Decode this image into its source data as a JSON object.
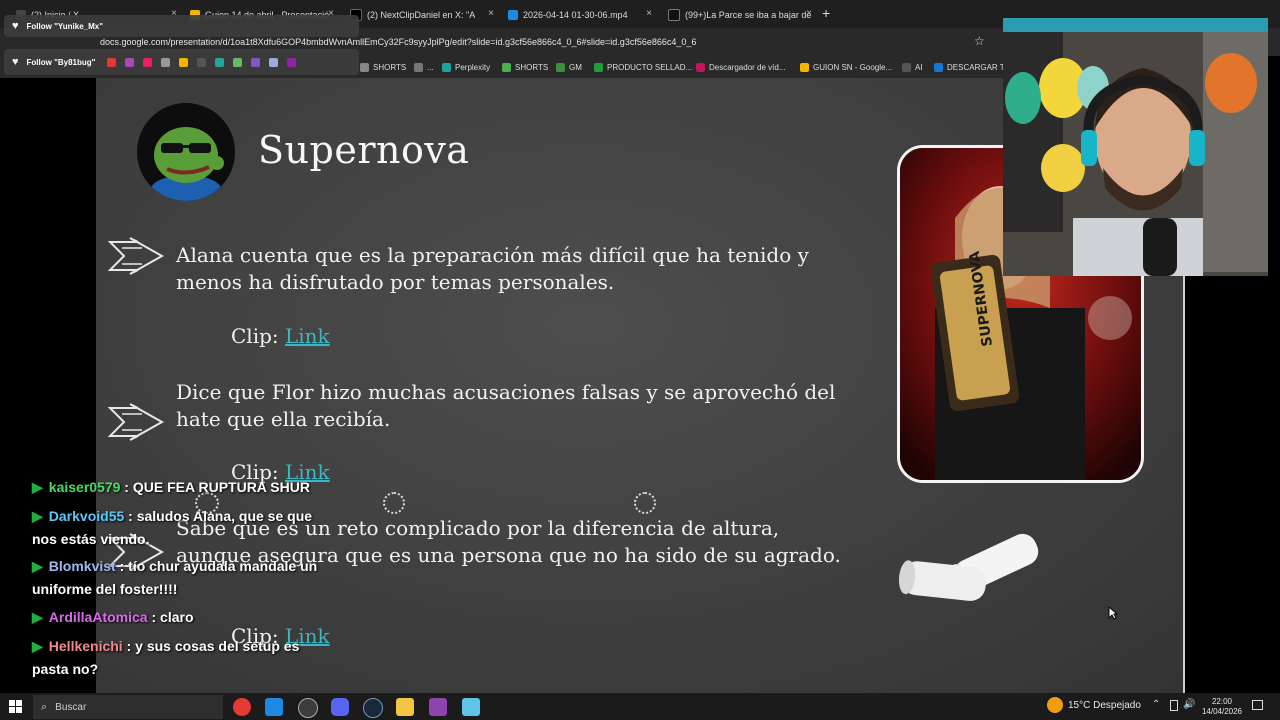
{
  "browser": {
    "tabs": [
      {
        "label": "(2) Inicio / X",
        "color": "#444"
      },
      {
        "label": "Guion 14 de abril - Presentació",
        "color": "#f4b400"
      },
      {
        "label": "(2) NextClipDaniel en X: \"A",
        "color": "#000"
      },
      {
        "label": "2026-04-14 01-30-06.mp4",
        "color": "#1e88e5"
      },
      {
        "label": "(99+)La Parce se iba a bajar de",
        "color": "#111"
      }
    ],
    "new_tab": "+",
    "url": "docs.google.com/presentation/d/1oa1t8Xdfu6GOP4bmbdWvnAmllEmCy32Fc9syyJplPg/edit?slide=id.g3cf56e866c4_0_6#slide=id.g3cf56e866c4_0_6",
    "bookmarks": [
      {
        "label": "SHORTS",
        "color": "#888"
      },
      {
        "label": "...",
        "color": "#777"
      },
      {
        "label": "Perplexity",
        "color": "#20a0a0"
      },
      {
        "label": "SHORTS",
        "color": "#4caf50"
      },
      {
        "label": "GM",
        "color": "#3b8f3b"
      },
      {
        "label": "PRODUCTO SELLAD...",
        "color": "#1e9e3e"
      },
      {
        "label": "Descargador de víd...",
        "color": "#c2185b"
      },
      {
        "label": "GUION SN - Google...",
        "color": "#f4b400"
      },
      {
        "label": "AI",
        "color": "#555"
      },
      {
        "label": "DESCARGAR TW",
        "color": "#1976d2"
      }
    ]
  },
  "follows": [
    "Follow \"Yunike_Mx\"",
    "Follow \"By81bug\""
  ],
  "slide": {
    "title": "Supernova",
    "items": [
      {
        "text": "Alana cuenta que es la preparación más difícil que ha tenido y menos ha disfrutado por temas personales.",
        "clip_label": "Clip:",
        "link": "Link"
      },
      {
        "text": "Dice que Flor hizo muchas acusaciones falsas y se aprovechó del hate que ella recibía.",
        "clip_label": "Clip:",
        "link": "Link"
      },
      {
        "text": "Sabe que es un reto complicado por la diferencia de altura, aunque asegura que es una persona que no ha sido de su agrado.",
        "clip_label": "Clip:",
        "link": "Link"
      }
    ]
  },
  "chat": [
    {
      "user": "kaiser0579",
      "color": "#4cd964",
      "msg": "QUE FEA RUPTURA SHUR"
    },
    {
      "user": "Darkvoid55",
      "color": "#5ac8fa",
      "msg": "saludos Alana, que se que nos estás viendo."
    },
    {
      "user": "Blomkvist",
      "color": "#9fb8f0",
      "msg": "tío chur ayudala mandale un uniforme del foster!!!!"
    },
    {
      "user": "ArdillaAtomica",
      "color": "#d96be8",
      "msg": "claro"
    },
    {
      "user": "Hellkenichi",
      "color": "#f08a8a",
      "msg": "y sus cosas del setup es pasta no?"
    }
  ],
  "taskbar": {
    "search_placeholder": "Buscar",
    "weather": "15°C Despejado",
    "time": "22:00",
    "date": "14/04/2026"
  }
}
